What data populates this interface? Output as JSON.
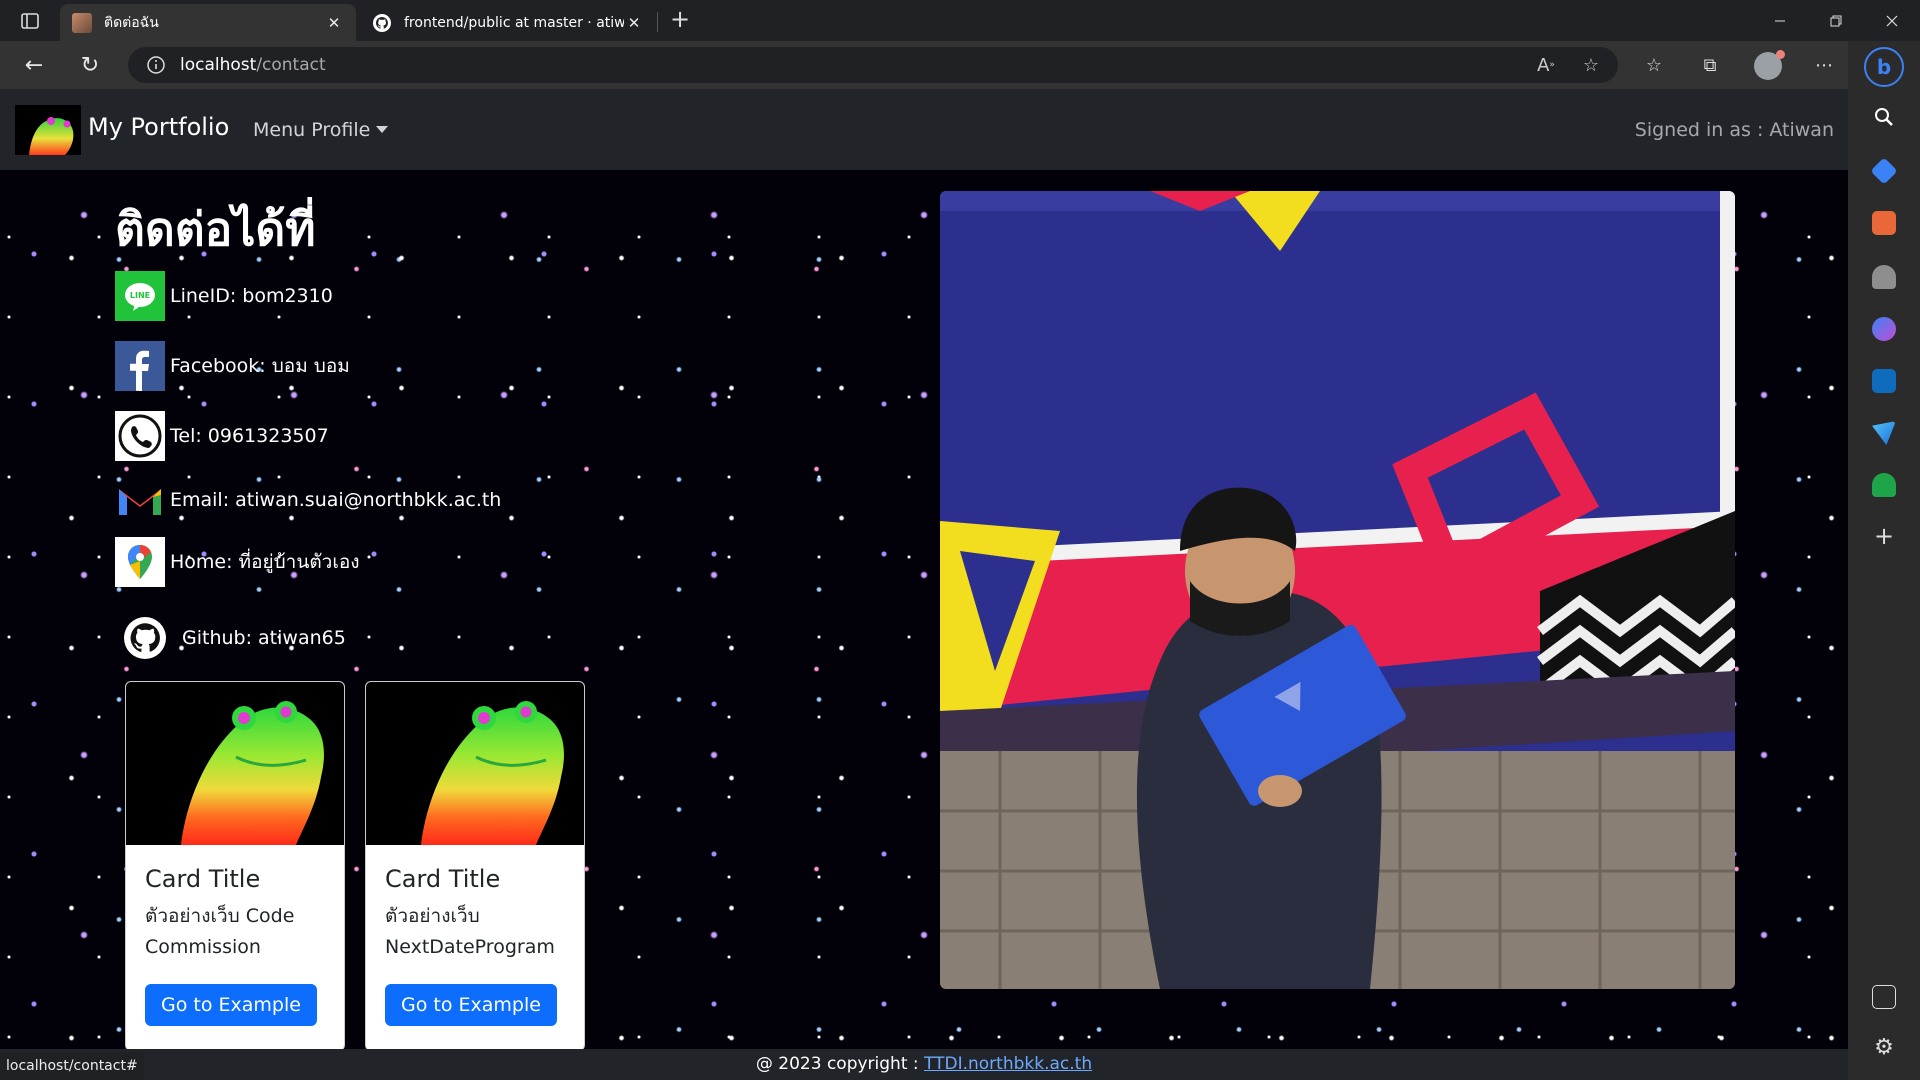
{
  "browser": {
    "tabs": [
      {
        "title": "ติดต่อฉัน",
        "active": true
      },
      {
        "title": "frontend/public at master · atiwa",
        "active": false
      }
    ],
    "address": {
      "host": "localhost",
      "path": "/contact"
    },
    "status_url": "localhost/contact#"
  },
  "navbar": {
    "brand": "My Portfolio",
    "menu": "Menu Profile",
    "signed_in": "Signed in as : Atiwan"
  },
  "contact": {
    "title": "ติดต่อได้ที่",
    "items": [
      {
        "icon": "line-icon",
        "text": "LineID: bom2310"
      },
      {
        "icon": "facebook-icon",
        "text": "Facebook: บอม บอม"
      },
      {
        "icon": "phone-icon",
        "text": "Tel: 0961323507"
      },
      {
        "icon": "gmail-icon",
        "text": "Email: atiwan.suai@northbkk.ac.th"
      },
      {
        "icon": "google-maps-icon",
        "text": "Home: ที่อยู่บ้านตัวเอง"
      }
    ],
    "github": "Github: atiwan65"
  },
  "cards": [
    {
      "title": "Card Title",
      "text": "ตัวอย่างเว็บ Code Commission",
      "button": "Go to Example"
    },
    {
      "title": "Card Title",
      "text": "ตัวอย่างเว็บ NextDateProgram",
      "button": "Go to Example"
    }
  ],
  "footer": {
    "prefix": "@ 2023 copyright : ",
    "link": "TTDI.northbkk.ac.th"
  },
  "colors": {
    "primary": "#0d6efd",
    "navbar": "#212529",
    "page_bg": "#02010a",
    "link": "#6ea8fe"
  }
}
